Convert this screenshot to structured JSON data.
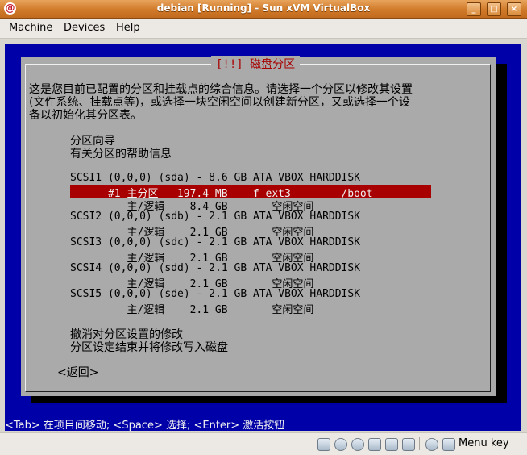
{
  "window": {
    "title": "debian [Running] - Sun xVM VirtualBox"
  },
  "menu": {
    "items": [
      "Machine",
      "Devices",
      "Help"
    ]
  },
  "installer": {
    "dialog_title": "[!!] 磁盘分区",
    "intro": [
      "这是您目前已配置的分区和挂载点的综合信息。请选择一个分区以修改其设置",
      "(文件系统、挂载点等)，或选择一块空闲空间以创建新分区，又或选择一个设",
      "备以初始化其分区表。"
    ],
    "guided": "分区向导",
    "help_info": "有关分区的帮助信息",
    "disks": [
      {
        "header": "SCSI1 (0,0,0) (sda) - 8.6 GB ATA VBOX HARDDISK"
      },
      {
        "row": "      #1 主分区   197.4 MB    f ext3        /boot",
        "selected": true
      },
      {
        "row": "         主/逻辑    8.4 GB       空闲空间"
      },
      {
        "header": "SCSI2 (0,0,0) (sdb) - 2.1 GB ATA VBOX HARDDISK"
      },
      {
        "row": "         主/逻辑    2.1 GB       空闲空间"
      },
      {
        "header": "SCSI3 (0,0,0) (sdc) - 2.1 GB ATA VBOX HARDDISK"
      },
      {
        "row": "         主/逻辑    2.1 GB       空闲空间"
      },
      {
        "header": "SCSI4 (0,0,0) (sdd) - 2.1 GB ATA VBOX HARDDISK"
      },
      {
        "row": "         主/逻辑    2.1 GB       空闲空间"
      },
      {
        "header": "SCSI5 (0,0,0) (sde) - 2.1 GB ATA VBOX HARDDISK"
      },
      {
        "row": "         主/逻辑    2.1 GB       空闲空间"
      }
    ],
    "undo": "撤消对分区设置的修改",
    "finish": "分区设定结束并将修改写入磁盘",
    "back": "<返回>",
    "help_line": "<Tab> 在项目间移动; <Space> 选择; <Enter> 激活按钮"
  },
  "status": {
    "host_key": "Menu key"
  }
}
